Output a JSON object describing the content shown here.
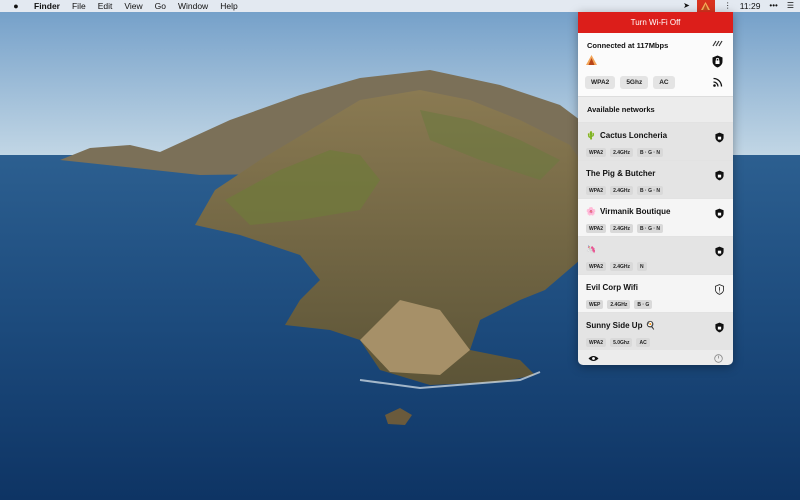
{
  "menubar": {
    "apple_icon": "apple-logo-icon",
    "app_name": "Finder",
    "menus": [
      "File",
      "Edit",
      "View",
      "Go",
      "Window",
      "Help"
    ],
    "clock": "11:29"
  },
  "panel": {
    "toggle_label": "Turn Wi-Fi Off",
    "toggle_color": "#dc1e1a",
    "connected": {
      "title": "Connected at 117Mbps",
      "tags": [
        "WPA2",
        "5Ghz",
        "AC"
      ]
    },
    "available_header": "Available networks",
    "networks": [
      {
        "name": "Cactus Loncheria",
        "emoji": "🌵",
        "tags": [
          "WPA2",
          "2.4GHz",
          "B · G · N"
        ],
        "secure_icon": "shield-lock-icon"
      },
      {
        "name": "The Pig & Butcher",
        "emoji": "",
        "tags": [
          "WPA2",
          "2.4GHz",
          "B · G · N"
        ],
        "secure_icon": "shield-lock-icon"
      },
      {
        "name": "Virmanik Boutique",
        "emoji": "🌸",
        "tags": [
          "WPA2",
          "2.4GHz",
          "B · G · N"
        ],
        "secure_icon": "shield-lock-icon"
      },
      {
        "name": "",
        "emoji": "🦄",
        "tags": [
          "WPA2",
          "2.4GHz",
          "N"
        ],
        "secure_icon": "shield-lock-icon"
      },
      {
        "name": "Evil Corp Wifi",
        "emoji": "",
        "tags": [
          "WEP",
          "2.4GHz",
          "B · G"
        ],
        "secure_icon": "shield-warning-icon"
      },
      {
        "name": "Sunny Side Up",
        "emoji_after": "🍳",
        "tags": [
          "WPA2",
          "5.0Ghz",
          "AC"
        ],
        "secure_icon": "shield-lock-icon"
      }
    ]
  }
}
